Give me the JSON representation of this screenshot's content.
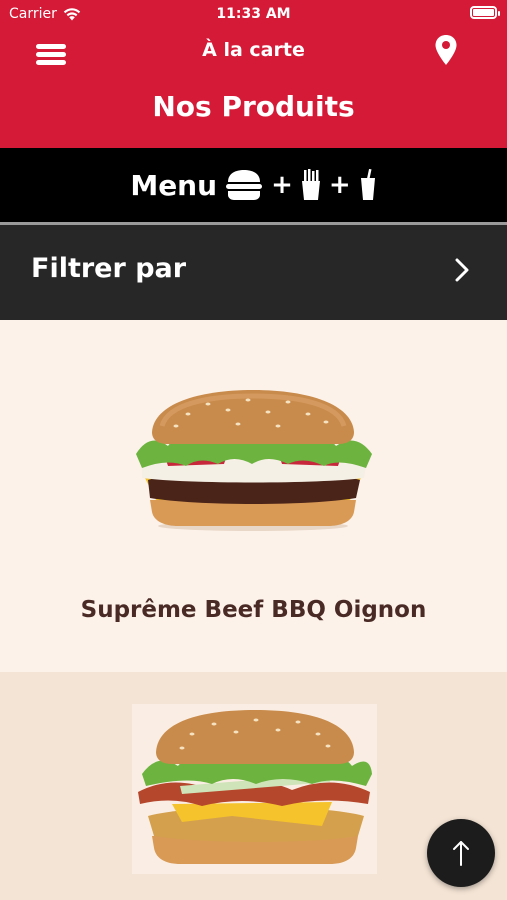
{
  "status_bar": {
    "carrier": "Carrier",
    "time": "11:33 AM"
  },
  "nav": {
    "title": "À la carte",
    "heading": "Nos Produits",
    "icons": [
      "menu-icon",
      "location-pin-icon"
    ]
  },
  "menu_banner": {
    "label": "Menu",
    "plus": "+",
    "icons": [
      "burger-icon",
      "fries-icon",
      "drink-icon"
    ]
  },
  "filter": {
    "label": "Filtrer par",
    "icon": "chevron-right-icon"
  },
  "products": [
    {
      "name": "Suprême Beef BBQ Oignon"
    }
  ],
  "fab": {
    "icon": "arrow-up-icon"
  },
  "colors": {
    "brand_red": "#d51a37",
    "banner_black": "#000000",
    "filter_bg": "#272727",
    "product_name": "#4a2a25",
    "card_bg": "#fcf2ea"
  }
}
